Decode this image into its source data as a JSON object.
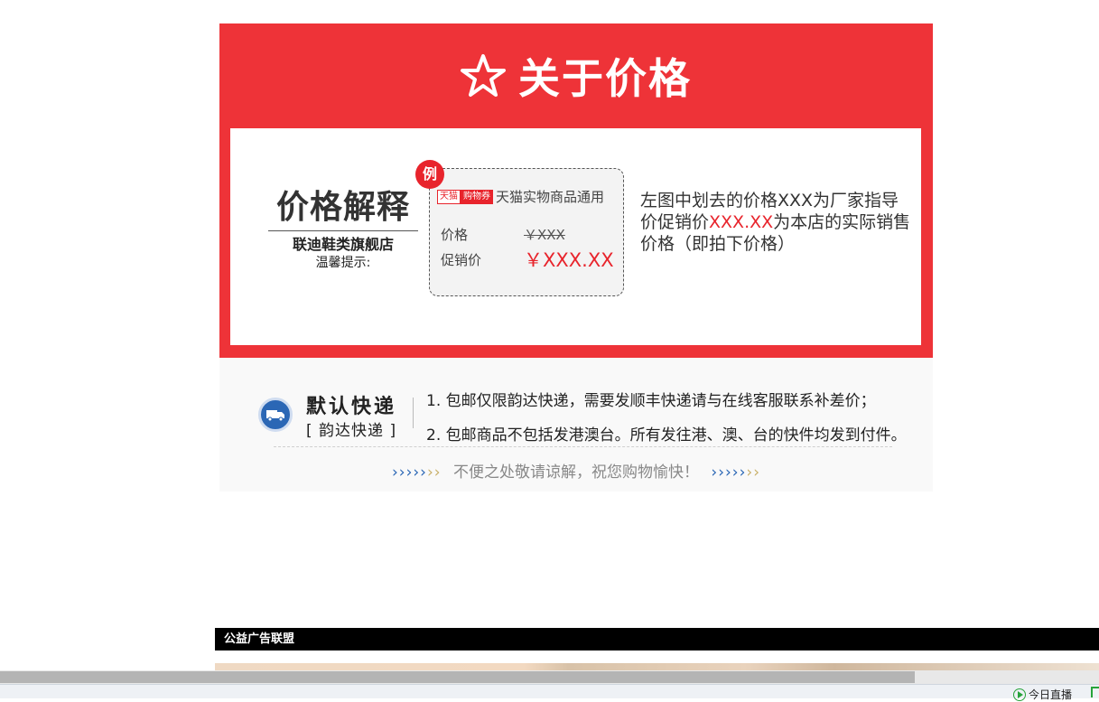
{
  "price_section": {
    "title": "关于价格",
    "explain_title": "价格解释",
    "store_name": "联迪鞋类旗舰店",
    "tip_label": "温馨提示:",
    "example": {
      "badge": "例",
      "tag_tmall": "天猫",
      "tag_coupon": "购物券",
      "general_text": "天猫实物商品通用",
      "price_label": "价格",
      "price_value": "￥XXX",
      "promo_label": "促销价",
      "promo_value": "￥XXX.XX"
    },
    "description": {
      "part1": "左图中划去的价格XXX为厂家指导价促销价",
      "highlight": "XXX.XX",
      "part2": "为本店的实际销售价格（即拍下价格）"
    }
  },
  "shipping": {
    "title": "默认快递",
    "subtitle": "[ 韵达快递 ]",
    "line1": "1. 包邮仅限韵达快递，需要发顺丰快递请与在线客服联系补差价；",
    "line2": "2. 包邮商品不包括发港澳台。所有发往港、澳、台的快件均发到付件。",
    "footer_text": "不便之处敬请谅解，祝您购物愉快！",
    "arrows": "›››››",
    "arrows_fade": "››"
  },
  "ad": {
    "label": "公益广告联盟"
  },
  "statusbar": {
    "live_label": "今日直播"
  },
  "colors": {
    "brand_red": "#ee3338",
    "accent_red": "#e8242c",
    "ship_blue": "#2b67b5"
  }
}
